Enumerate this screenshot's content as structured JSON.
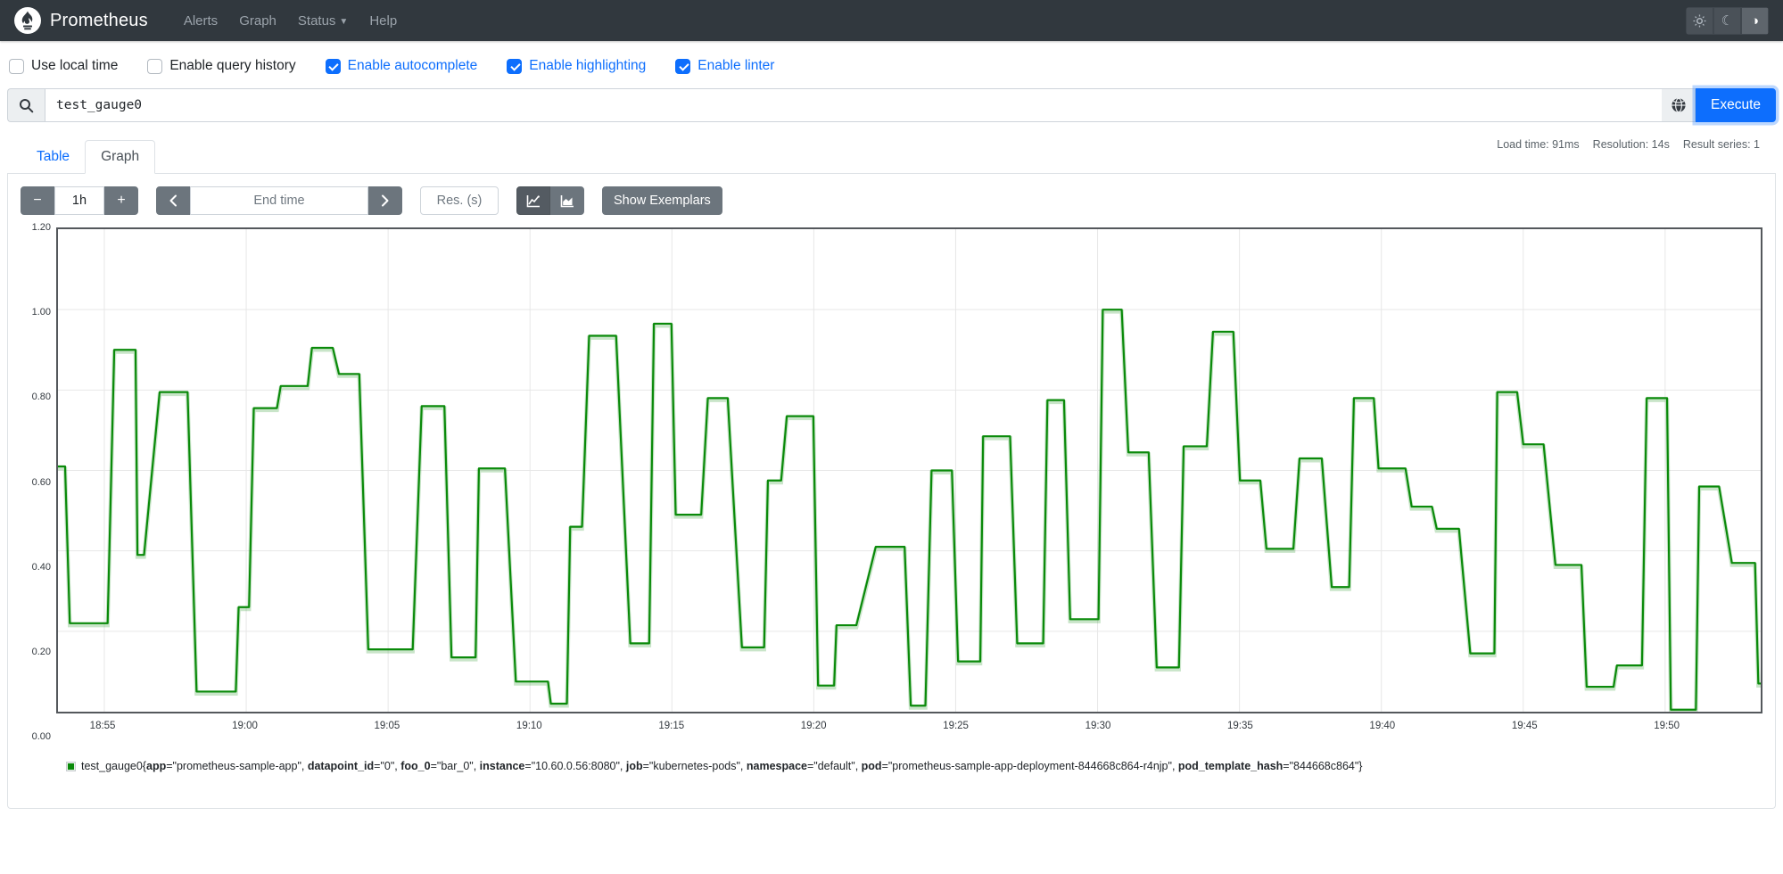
{
  "navbar": {
    "brand": "Prometheus",
    "items": [
      {
        "label": "Alerts",
        "caret": false
      },
      {
        "label": "Graph",
        "caret": false
      },
      {
        "label": "Status",
        "caret": true
      },
      {
        "label": "Help",
        "caret": false
      }
    ],
    "theme": {
      "light_icon": "sun",
      "dark_icon": "moon",
      "auto_icon": "half-circle",
      "active": "auto",
      "auto_glyph": "◑",
      "moon_glyph": "☾"
    }
  },
  "options": [
    {
      "label": "Use local time",
      "checked": false
    },
    {
      "label": "Enable query history",
      "checked": false
    },
    {
      "label": "Enable autocomplete",
      "checked": true
    },
    {
      "label": "Enable highlighting",
      "checked": true
    },
    {
      "label": "Enable linter",
      "checked": true
    }
  ],
  "query": {
    "value": "test_gauge0",
    "execute_label": "Execute",
    "search_icon": "magnifier",
    "explorer_icon": "globe"
  },
  "stats": {
    "load_time": "Load time: 91ms",
    "resolution": "Resolution: 14s",
    "result_series": "Result series: 1"
  },
  "tabs": [
    {
      "label": "Table",
      "active": false
    },
    {
      "label": "Graph",
      "active": true
    }
  ],
  "graph_controls": {
    "decrease_label": "−",
    "duration_value": "1h",
    "increase_label": "+",
    "back_icon": "chevron-left",
    "end_time_placeholder": "End time",
    "forward_icon": "chevron-right",
    "res_placeholder": "Res. (s)",
    "chart_toggle": {
      "line_icon": "line-chart",
      "stacked_icon": "stacked-area-chart",
      "active": "line"
    },
    "show_exemplars_label": "Show Exemplars"
  },
  "chart_data": {
    "type": "line",
    "title": "",
    "xlabel": "",
    "ylabel": "",
    "ylim": [
      0,
      1.2
    ],
    "grid": true,
    "legend_position": "bottom",
    "x_window_seconds": 3600,
    "x_ticks": [
      {
        "pos": 98,
        "label": "18:55"
      },
      {
        "pos": 398,
        "label": "19:00"
      },
      {
        "pos": 698,
        "label": "19:05"
      },
      {
        "pos": 998,
        "label": "19:10"
      },
      {
        "pos": 1298,
        "label": "19:15"
      },
      {
        "pos": 1598,
        "label": "19:20"
      },
      {
        "pos": 1898,
        "label": "19:25"
      },
      {
        "pos": 2198,
        "label": "19:30"
      },
      {
        "pos": 2498,
        "label": "19:35"
      },
      {
        "pos": 2798,
        "label": "19:40"
      },
      {
        "pos": 3098,
        "label": "19:45"
      },
      {
        "pos": 3398,
        "label": "19:50"
      }
    ],
    "y_ticks": [
      {
        "value": 0,
        "label": "0.00"
      },
      {
        "value": 0.2,
        "label": "0.20"
      },
      {
        "value": 0.4,
        "label": "0.40"
      },
      {
        "value": 0.6,
        "label": "0.60"
      },
      {
        "value": 0.8,
        "label": "0.80"
      },
      {
        "value": 1.0,
        "label": "1.00"
      },
      {
        "value": 1.2,
        "label": "1.20"
      }
    ],
    "series": [
      {
        "name": "test_gauge0",
        "color": "#0a8a0a",
        "plateaus": [
          [
            0,
            15,
            0.61
          ],
          [
            25,
            105,
            0.22
          ],
          [
            119,
            164,
            0.9
          ],
          [
            168,
            182,
            0.39
          ],
          [
            215,
            274,
            0.795
          ],
          [
            293,
            376,
            0.05
          ],
          [
            382,
            404,
            0.26
          ],
          [
            414,
            463,
            0.755
          ],
          [
            471,
            528,
            0.81
          ],
          [
            537,
            581,
            0.905
          ],
          [
            594,
            637,
            0.84
          ],
          [
            656,
            750,
            0.155
          ],
          [
            769,
            817,
            0.76
          ],
          [
            832,
            883,
            0.135
          ],
          [
            890,
            945,
            0.605
          ],
          [
            968,
            1036,
            0.075
          ],
          [
            1042,
            1076,
            0.02
          ],
          [
            1083,
            1108,
            0.46
          ],
          [
            1123,
            1180,
            0.935
          ],
          [
            1210,
            1250,
            0.17
          ],
          [
            1260,
            1297,
            0.965
          ],
          [
            1306,
            1360,
            0.49
          ],
          [
            1374,
            1416,
            0.78
          ],
          [
            1446,
            1493,
            0.16
          ],
          [
            1501,
            1529,
            0.575
          ],
          [
            1541,
            1597,
            0.735
          ],
          [
            1607,
            1641,
            0.065
          ],
          [
            1646,
            1688,
            0.215
          ],
          [
            1729,
            1790,
            0.41
          ],
          [
            1803,
            1834,
            0.015
          ],
          [
            1847,
            1890,
            0.6
          ],
          [
            1903,
            1950,
            0.125
          ],
          [
            1956,
            2013,
            0.685
          ],
          [
            2028,
            2083,
            0.17
          ],
          [
            2092,
            2127,
            0.775
          ],
          [
            2140,
            2200,
            0.23
          ],
          [
            2209,
            2249,
            1.0
          ],
          [
            2263,
            2306,
            0.645
          ],
          [
            2323,
            2370,
            0.11
          ],
          [
            2380,
            2429,
            0.66
          ],
          [
            2442,
            2485,
            0.945
          ],
          [
            2499,
            2542,
            0.575
          ],
          [
            2555,
            2612,
            0.405
          ],
          [
            2625,
            2672,
            0.63
          ],
          [
            2693,
            2730,
            0.31
          ],
          [
            2740,
            2782,
            0.78
          ],
          [
            2792,
            2849,
            0.605
          ],
          [
            2862,
            2905,
            0.51
          ],
          [
            2915,
            2962,
            0.455
          ],
          [
            2986,
            3037,
            0.145
          ],
          [
            3043,
            3085,
            0.795
          ],
          [
            3098,
            3141,
            0.665
          ],
          [
            3166,
            3221,
            0.365
          ],
          [
            3232,
            3289,
            0.062
          ],
          [
            3296,
            3349,
            0.115
          ],
          [
            3359,
            3402,
            0.78
          ],
          [
            3410,
            3463,
            0.005
          ],
          [
            3470,
            3512,
            0.56
          ],
          [
            3539,
            3588,
            0.37
          ],
          [
            3595,
            3600,
            0.07
          ]
        ]
      }
    ]
  },
  "legend": {
    "swatch_color": "#0a8a0a",
    "metric": "test_gauge0",
    "labels": [
      [
        "app",
        "prometheus-sample-app"
      ],
      [
        "datapoint_id",
        "0"
      ],
      [
        "foo_0",
        "bar_0"
      ],
      [
        "instance",
        "10.60.0.56:8080"
      ],
      [
        "job",
        "kubernetes-pods"
      ],
      [
        "namespace",
        "default"
      ],
      [
        "pod",
        "prometheus-sample-app-deployment-844668c864-r4njp"
      ],
      [
        "pod_template_hash",
        "844668c864"
      ]
    ]
  }
}
